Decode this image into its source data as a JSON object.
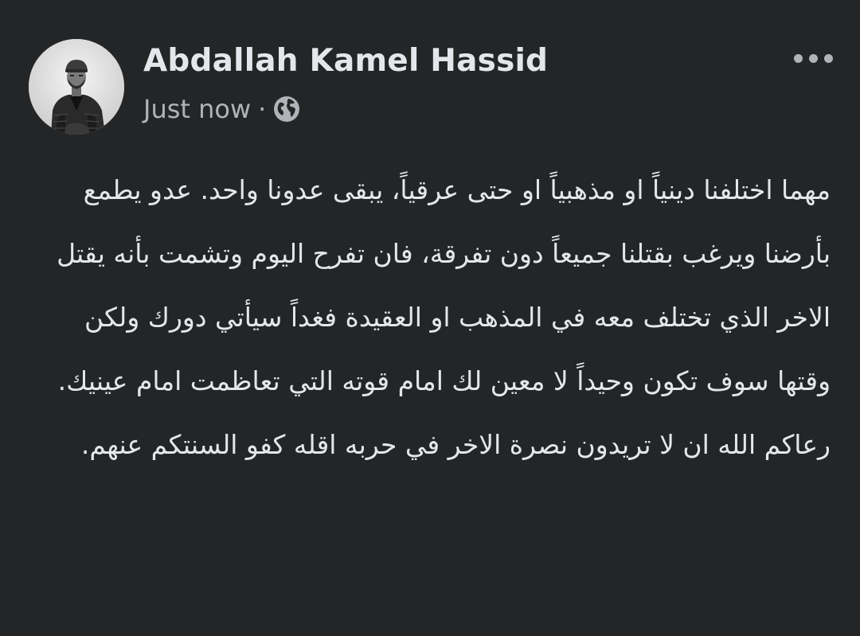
{
  "post": {
    "author": "Abdallah Kamel Hassid",
    "timestamp": "Just now",
    "separator": "·",
    "audience_icon": "globe-icon",
    "more_icon": "more-options-icon",
    "text": "مهما اختلفنا دينياً او مذهبياً او حتى عرقياً، يبقى عدونا واحد. عدو يطمع بأرضنا ويرغب بقتلنا جميعاً دون تفرقة، فان تفرح اليوم وتشمت بأنه يقتل الاخر الذي تختلف معه في المذهب او العقيدة فغداً سيأتي دورك ولكن وقتها سوف تكون وحيداً لا معين لك امام قوته التي تعاظمت امام عينيك. رعاكم الله ان لا تريدون نصرة الاخر في حربه اقله كفو السنتكم عنهم."
  },
  "colors": {
    "background": "#242526",
    "primary_text": "#e4e6eb",
    "secondary_text": "#b0b3b8"
  }
}
